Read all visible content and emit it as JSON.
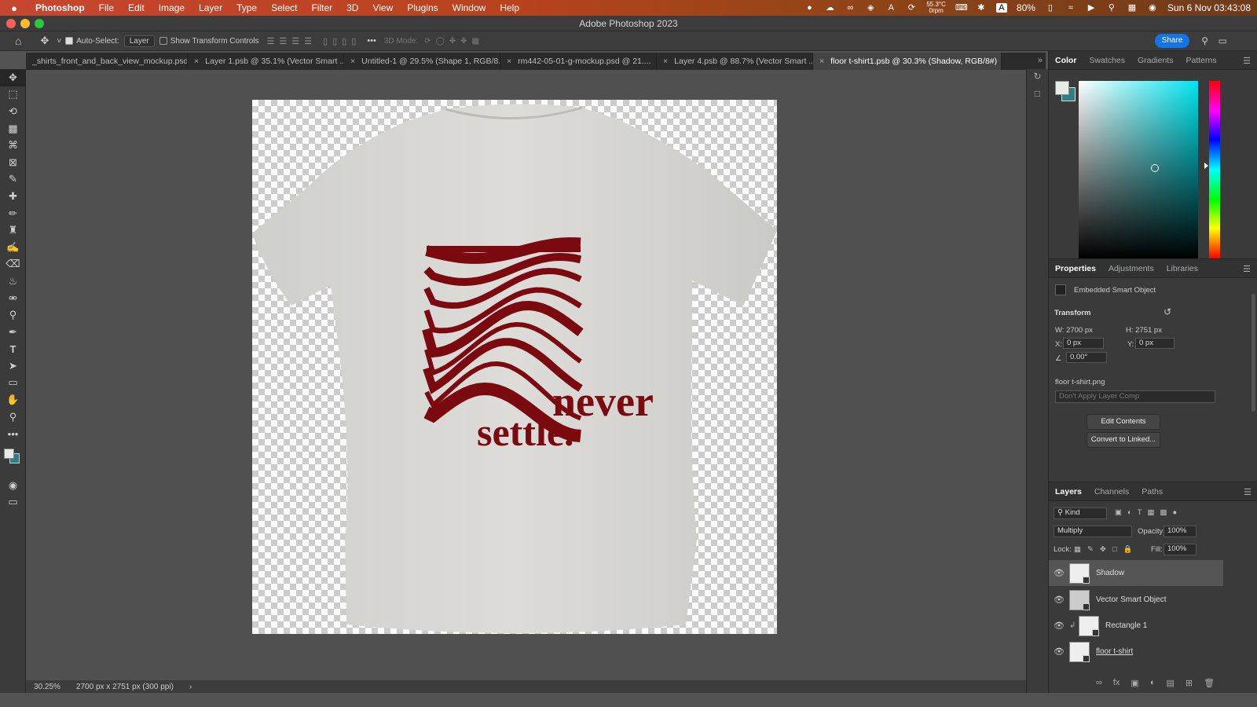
{
  "menubar": {
    "apple": "",
    "app": "Photoshop",
    "items": [
      "File",
      "Edit",
      "Image",
      "Layer",
      "Type",
      "Select",
      "Filter",
      "3D",
      "View",
      "Plugins",
      "Window",
      "Help"
    ],
    "temp": "55.3°C",
    "temp2": "0rpm",
    "battery": "80%",
    "clock": "Sun 6 Nov  03:43:08"
  },
  "window": {
    "title": "Adobe Photoshop 2023"
  },
  "options": {
    "auto_select_label": "Auto-Select:",
    "auto_select_value": "Layer",
    "transform_label": "Show Transform Controls",
    "mode3d": "3D Mode:",
    "share": "Share"
  },
  "tabs": [
    {
      "label": "_shirts_front_and_back_view_mockup.psd",
      "active": false
    },
    {
      "label": "Layer 1.psb @ 35.1% (Vector Smart ...",
      "active": false
    },
    {
      "label": "Untitled-1 @ 29.5% (Shape 1, RGB/8...",
      "active": false
    },
    {
      "label": "rm442-05-01-g-mockup.psd @ 21....",
      "active": false
    },
    {
      "label": "Layer 4.psb @ 88.7% (Vector Smart ...",
      "active": false
    },
    {
      "label": "floor t-shirt1.psb @ 30.3% (Shadow, RGB/8#)",
      "active": true
    }
  ],
  "artwork": {
    "line1": "never",
    "line2": "settle.",
    "ink_color": "#7a0a0f",
    "shirt_color": "#d8d8d4"
  },
  "status": {
    "zoom": "30.25%",
    "dims": "2700 px x 2751 px (300 ppi)"
  },
  "color_panel": {
    "tabs": [
      "Color",
      "Swatches",
      "Gradients",
      "Patterns"
    ],
    "fg": "#e8ebe8",
    "bg": "#2d7f85"
  },
  "properties": {
    "tabs": [
      "Properties",
      "Adjustments",
      "Libraries"
    ],
    "object_type": "Embedded Smart Object",
    "transform_title": "Transform",
    "w": "W:  2700 px",
    "h": "H:  2751 px",
    "x_label": "X:",
    "x": "0 px",
    "y_label": "Y:",
    "y": "0 px",
    "angle": "0.00°",
    "file": "floor t-shirt.png",
    "comp": "Don't Apply Layer Comp",
    "edit_btn": "Edit Contents",
    "convert_btn": "Convert to Linked..."
  },
  "layers": {
    "tabs": [
      "Layers",
      "Channels",
      "Paths"
    ],
    "kind": "Kind",
    "blend": "Multiply",
    "opacity_label": "Opacity:",
    "opacity": "100%",
    "lock_label": "Lock:",
    "fill_label": "Fill:",
    "fill": "100%",
    "items": [
      {
        "name": "Shadow",
        "selected": true
      },
      {
        "name": "Vector Smart Object",
        "selected": false
      },
      {
        "name": "Rectangle 1",
        "selected": false
      },
      {
        "name": "floor t-shirt",
        "selected": false
      }
    ]
  }
}
